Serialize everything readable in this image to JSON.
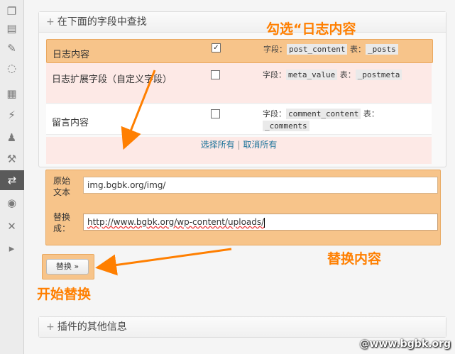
{
  "search_box": {
    "title": "在下面的字段中查找",
    "rows": [
      {
        "label": "日志内容",
        "checked": "✓",
        "field_label": "字段：",
        "field": "post_content",
        "table_label": "表：",
        "table": "_posts"
      },
      {
        "label": "日志扩展字段（自定义字段）",
        "checked": "",
        "field_label": "字段：",
        "field": "meta_value",
        "table_label": "表：",
        "table": "_postmeta"
      },
      {
        "label": "留言内容",
        "checked": "",
        "field_label": "字段：",
        "field": "comment_content",
        "table_label": "表：",
        "table": "_comments"
      }
    ],
    "select_all": "选择所有",
    "separator": "|",
    "deselect_all": "取消所有"
  },
  "replace": {
    "original_label": "原始文本",
    "original_value": "img.bgbk.org/img/",
    "replace_label": "替换成：",
    "replace_value": "http://www.bgbk.org/wp-content/uploads/",
    "button_label": "替换 »"
  },
  "other_box": {
    "title": "插件的其他信息"
  },
  "annotations": {
    "check_note": "勾选“日志内容",
    "replace_note": "替换内容",
    "start_note": "开始替换"
  },
  "watermark": "@www.bgbk.org",
  "colors": {
    "accent": "#ff7f00",
    "highlight": "#f7c48a",
    "link": "#21759b",
    "pink_row": "#fde9e6"
  },
  "sidebar_icons": [
    "copy-icon",
    "pages-icon",
    "pin-icon",
    "comment-icon",
    "appearance-icon",
    "plugin-icon",
    "users-icon",
    "tools-icon",
    "search-replace-icon",
    "settings-icon",
    "wrench-icon",
    "play-icon"
  ]
}
